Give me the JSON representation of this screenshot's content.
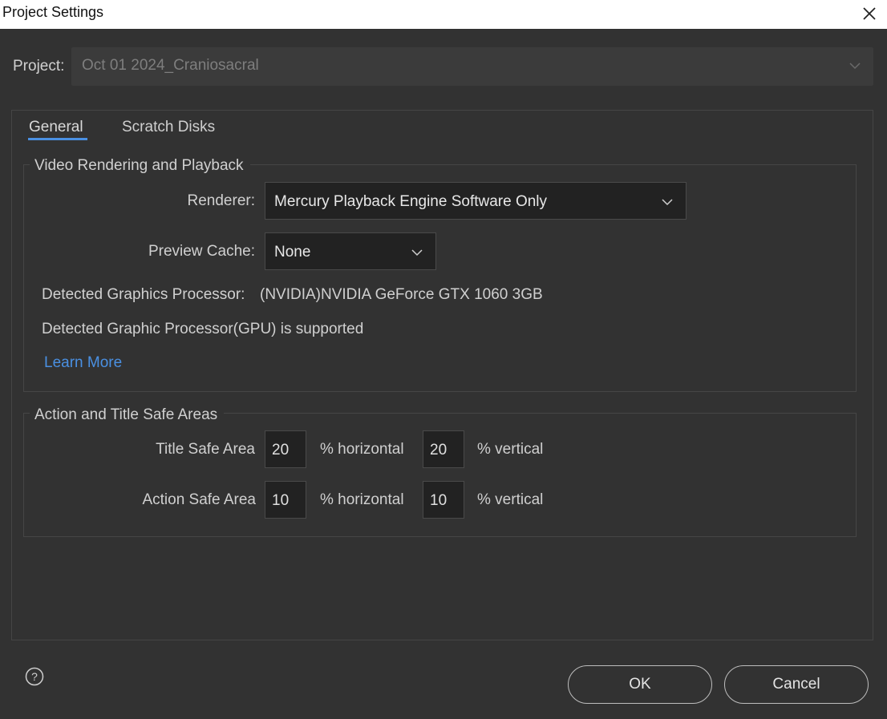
{
  "window": {
    "title": "Project Settings"
  },
  "project": {
    "label": "Project:",
    "value": "Oct 01 2024_Craniosacral"
  },
  "tabs": {
    "general": "General",
    "scratch": "Scratch Disks",
    "active": "General"
  },
  "video": {
    "legend": "Video Rendering and Playback",
    "renderer_label": "Renderer:",
    "renderer_value": "Mercury Playback Engine Software Only",
    "cache_label": "Preview Cache:",
    "cache_value": "None",
    "gpu_label": "Detected Graphics Processor:",
    "gpu_value": "(NVIDIA)NVIDIA GeForce GTX 1060 3GB",
    "gpu_supported": "Detected Graphic Processor(GPU) is supported",
    "learn_more": "Learn More"
  },
  "safe": {
    "legend": "Action and Title Safe Areas",
    "title_label": "Title Safe Area",
    "title_h": "20",
    "title_v": "20",
    "action_label": "Action Safe Area",
    "action_h": "10",
    "action_v": "10",
    "horizontal": "% horizontal",
    "vertical": "% vertical"
  },
  "buttons": {
    "ok": "OK",
    "cancel": "Cancel"
  },
  "colors": {
    "accent": "#4a90e2",
    "background": "#323232",
    "field": "#222222"
  },
  "icons": {
    "close": "close-icon",
    "chevron": "chevron-down-icon",
    "help": "help-icon"
  }
}
